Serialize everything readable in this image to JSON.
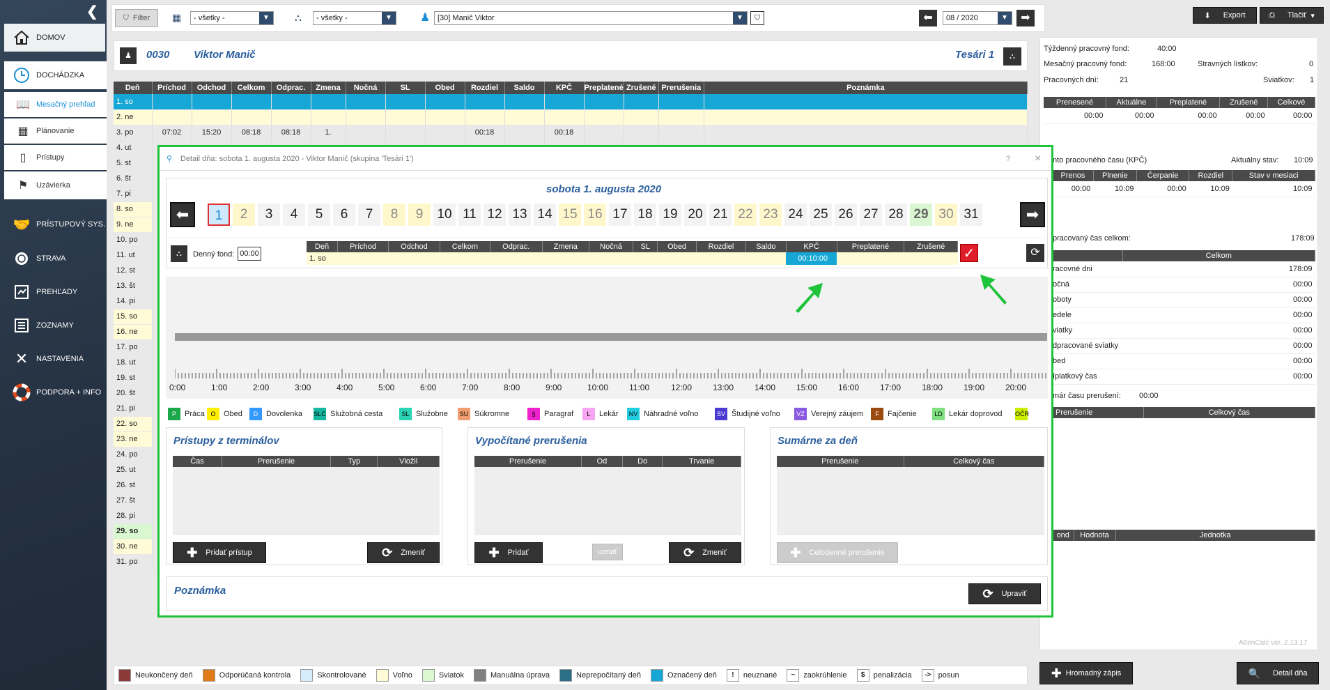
{
  "sidebar": {
    "nav": [
      {
        "label": "DOMOV",
        "icon": "home-icon"
      },
      {
        "label": "DOCHÁDZKA",
        "icon": "clock-icon"
      },
      {
        "label": "PRÍSTUPOVÝ SYS.",
        "icon": "handshake-icon"
      },
      {
        "label": "STRAVA",
        "icon": "plate-icon"
      },
      {
        "label": "PREHĽADY",
        "icon": "report-icon"
      },
      {
        "label": "ZOZNAMY",
        "icon": "list-icon"
      },
      {
        "label": "NASTAVENIA",
        "icon": "tools-icon"
      },
      {
        "label": "PODPORA + INFO",
        "icon": "lifebuoy-icon"
      }
    ],
    "sub": [
      {
        "label": "Mesačný prehľad",
        "icon": "book-icon"
      },
      {
        "label": "Plánovanie",
        "icon": "calendar-icon"
      },
      {
        "label": "Prístupy",
        "icon": "door-icon"
      },
      {
        "label": "Uzávierka",
        "icon": "flag-icon"
      }
    ]
  },
  "toolbar": {
    "filter": "Filter",
    "group_value": "- všetky -",
    "hier_value": "- všetky -",
    "employee_value": "[30] Manič Viktor",
    "month_value": "08 / 2020",
    "export": "Export",
    "print": "Tlačiť"
  },
  "employee": {
    "id": "0030",
    "name": "Viktor Manič",
    "group": "Tesári 1"
  },
  "grid": {
    "headers": [
      "Deň",
      "Príchod",
      "Odchod",
      "Celkom",
      "Odprac.",
      "Zmena",
      "Nočná",
      "SL",
      "Obed",
      "Rozdiel",
      "Saldo",
      "KPČ",
      "Preplatené",
      "Zrušené",
      "Prerušenia",
      "Poznámka"
    ],
    "rows": [
      [
        "1. so",
        "",
        "",
        "",
        "",
        "",
        "",
        "",
        "",
        "",
        "",
        "",
        "",
        "",
        "",
        ""
      ],
      [
        "2. ne",
        "",
        "",
        "",
        "",
        "",
        "",
        "",
        "",
        "",
        "",
        "",
        "",
        "",
        "",
        ""
      ],
      [
        "3. po",
        "07:02",
        "15:20",
        "08:18",
        "08:18",
        "1.",
        "",
        "",
        "",
        "00:18",
        "",
        "00:18",
        "",
        "",
        "",
        ""
      ],
      [
        "4. ut"
      ],
      [
        "5. st"
      ],
      [
        "6. št"
      ],
      [
        "7. pi"
      ],
      [
        "8. so"
      ],
      [
        "9. ne"
      ],
      [
        "10. po"
      ],
      [
        "11. ut"
      ],
      [
        "12. st"
      ],
      [
        "13. št"
      ],
      [
        "14. pi"
      ],
      [
        "15. so"
      ],
      [
        "16. ne"
      ],
      [
        "17. po"
      ],
      [
        "18. ut"
      ],
      [
        "19. st"
      ],
      [
        "20. št"
      ],
      [
        "21. pi"
      ],
      [
        "22. so"
      ],
      [
        "23. ne"
      ],
      [
        "24. po"
      ],
      [
        "25. ut"
      ],
      [
        "26. st"
      ],
      [
        "27. št"
      ],
      [
        "28. pi"
      ],
      [
        "29. so"
      ],
      [
        "30. ne"
      ],
      [
        "31. po"
      ]
    ]
  },
  "right": {
    "weekly_fund_label": "Týždenný pracovný fond:",
    "weekly_fund": "40:00",
    "monthly_fund_label": "Mesačný pracovný fond:",
    "monthly_fund": "168:00",
    "meal_label": "Stravných lístkov:",
    "meal": "0",
    "workdays_label": "Pracovných dní:",
    "workdays": "21",
    "holidays_label": "Sviatkov:",
    "holidays": "1",
    "t1_headers": [
      "Prenesené",
      "Aktuálne",
      "Preplatené",
      "Zrušené",
      "Celkové"
    ],
    "t1_values": [
      "00:00",
      "00:00",
      "00:00",
      "00:00",
      "00:00"
    ],
    "kpc_label": "nto pracovného času (KPČ)",
    "kpc_state_label": "Aktuálny stav:",
    "kpc_state": "10:09",
    "t2_headers": [
      "Prenos",
      "Plnenie",
      "Čerpanie",
      "Rozdiel",
      "Stav v mesiaci"
    ],
    "t2_values": [
      "00:00",
      "10:09",
      "00:00",
      "10:09",
      "10:09"
    ],
    "worked_label": "pracovaný čas celkom:",
    "worked": "178:09",
    "t3_header": "Celkom",
    "t3_rows": [
      [
        "racovné dni",
        "178:09"
      ],
      [
        "očná",
        "00:00"
      ],
      [
        "oboty",
        "00:00"
      ],
      [
        "edele",
        "00:00"
      ],
      [
        "viatky",
        "00:00"
      ],
      [
        "dpracované sviatky",
        "00:00"
      ],
      [
        "bed",
        "00:00"
      ],
      [
        "íplatkový čas",
        "00:00"
      ]
    ],
    "break_sum_label": "már času prerušení:",
    "break_sum": "00:00",
    "t4_headers": [
      "Prerušenie",
      "Celkový čas"
    ],
    "t5_headers": [
      "ond",
      "Hodnota",
      "Jednotka"
    ],
    "version": "AttenCalc ver. 2.13.17",
    "bulk": "Hromadný zápis",
    "detail": "Detail dňa"
  },
  "legend": [
    {
      "label": "Neukončený deň",
      "color": "#8b3a3a"
    },
    {
      "label": "Odporúčaná kontrola",
      "color": "#e07b1a"
    },
    {
      "label": "Skontrolované",
      "color": "#d4ecfb"
    },
    {
      "label": "Voľno",
      "color": "#fffbd6"
    },
    {
      "label": "Sviatok",
      "color": "#d9f7d1"
    },
    {
      "label": "Manuálna úprava",
      "color": "#808080"
    },
    {
      "label": "Neprepočítaný deň",
      "color": "#2c6e86"
    },
    {
      "label": "Označený deň",
      "color": "#17a7d6"
    },
    {
      "sym": "!",
      "label": "neuznané"
    },
    {
      "sym": "~",
      "label": "zaokrúhlenie"
    },
    {
      "sym": "$",
      "label": "penalizácia"
    },
    {
      "sym": "->",
      "label": "posun"
    }
  ],
  "dialog": {
    "title": "Detail dňa: sobota 1. augusta 2020 -  Viktor Manič  (skupina 'Tesári 1')",
    "date": "sobota 1. augusta 2020",
    "days": [
      "1",
      "2",
      "3",
      "4",
      "5",
      "6",
      "7",
      "8",
      "9",
      "10",
      "11",
      "12",
      "13",
      "14",
      "15",
      "16",
      "17",
      "18",
      "19",
      "20",
      "21",
      "22",
      "23",
      "24",
      "25",
      "26",
      "27",
      "28",
      "29",
      "30",
      "31"
    ],
    "fund_label": "Denný fond:",
    "fund": "00:00",
    "day_headers": [
      "Deň",
      "Príchod",
      "Odchod",
      "Celkom",
      "Odprac.",
      "Zmena",
      "Nočná",
      "SL",
      "Obed",
      "Rozdiel",
      "Saldo",
      "KPČ",
      "Preplatené",
      "Zrušené"
    ],
    "day_row": [
      "1. so",
      "",
      "",
      "",
      "",
      "",
      "",
      "",
      "",
      "",
      "",
      "00:10:00",
      "",
      ""
    ],
    "hours": [
      "0:00",
      "1:00",
      "2:00",
      "3:00",
      "4:00",
      "5:00",
      "6:00",
      "7:00",
      "8:00",
      "9:00",
      "10:00",
      "11:00",
      "12:00",
      "13:00",
      "14:00",
      "15:00",
      "16:00",
      "17:00",
      "18:00",
      "19:00",
      "20:00"
    ],
    "categories": [
      {
        "code": "P",
        "label": "Práca",
        "color": "#1aa84a",
        "fg": "#fff"
      },
      {
        "code": "O",
        "label": "Obed",
        "color": "#ffee00",
        "fg": "#000"
      },
      {
        "code": "D",
        "label": "Dovolenka",
        "color": "#3399ff",
        "fg": "#fff"
      },
      {
        "code": "SLC",
        "label": "Služobná cesta",
        "color": "#14b8a0",
        "fg": "#000"
      },
      {
        "code": "SL",
        "label": "Služobne",
        "color": "#2ad4b5",
        "fg": "#000"
      },
      {
        "code": "SU",
        "label": "Súkromne",
        "color": "#f0a070",
        "fg": "#000"
      },
      {
        "code": "§",
        "label": "Paragraf",
        "color": "#ee22cc",
        "fg": "#000"
      },
      {
        "code": "L",
        "label": "Lekár",
        "color": "#f6a6f0",
        "fg": "#000"
      },
      {
        "code": "NV",
        "label": "Náhradné voľno",
        "color": "#22cce0",
        "fg": "#000"
      },
      {
        "code": "SV",
        "label": "Študijné voľno",
        "color": "#4a3bd0",
        "fg": "#fff"
      },
      {
        "code": "VZ",
        "label": "Verejný záujem",
        "color": "#8a5ae0",
        "fg": "#fff"
      },
      {
        "code": "F",
        "label": "Fajčenie",
        "color": "#9b4a10",
        "fg": "#fff"
      },
      {
        "code": "LD",
        "label": "Lekár doprovod",
        "color": "#7ee07e",
        "fg": "#000"
      },
      {
        "code": "OČR",
        "label": "OČR",
        "color": "#ccee00",
        "fg": "#000"
      }
    ],
    "card1": {
      "title": "Prístupy z terminálov",
      "headers": [
        "Čas",
        "Prerušenie",
        "Typ",
        "Vložil"
      ],
      "add": "Pridať prístup",
      "change": "Zmeniť"
    },
    "card2": {
      "title": "Vypočítané prerušenia",
      "headers": [
        "Prerušenie",
        "Od",
        "Do",
        "Trvanie"
      ],
      "add": "Pridať",
      "accept": "uznať",
      "change": "Zmeniť"
    },
    "card3": {
      "title": "Sumárne za deň",
      "headers": [
        "Prerušenie",
        "Celkový čas"
      ],
      "fullday": "Celodenné prerušenie"
    },
    "note_label": "Poznámka",
    "edit": "Upraviť",
    "help": "?",
    "close": "×"
  }
}
